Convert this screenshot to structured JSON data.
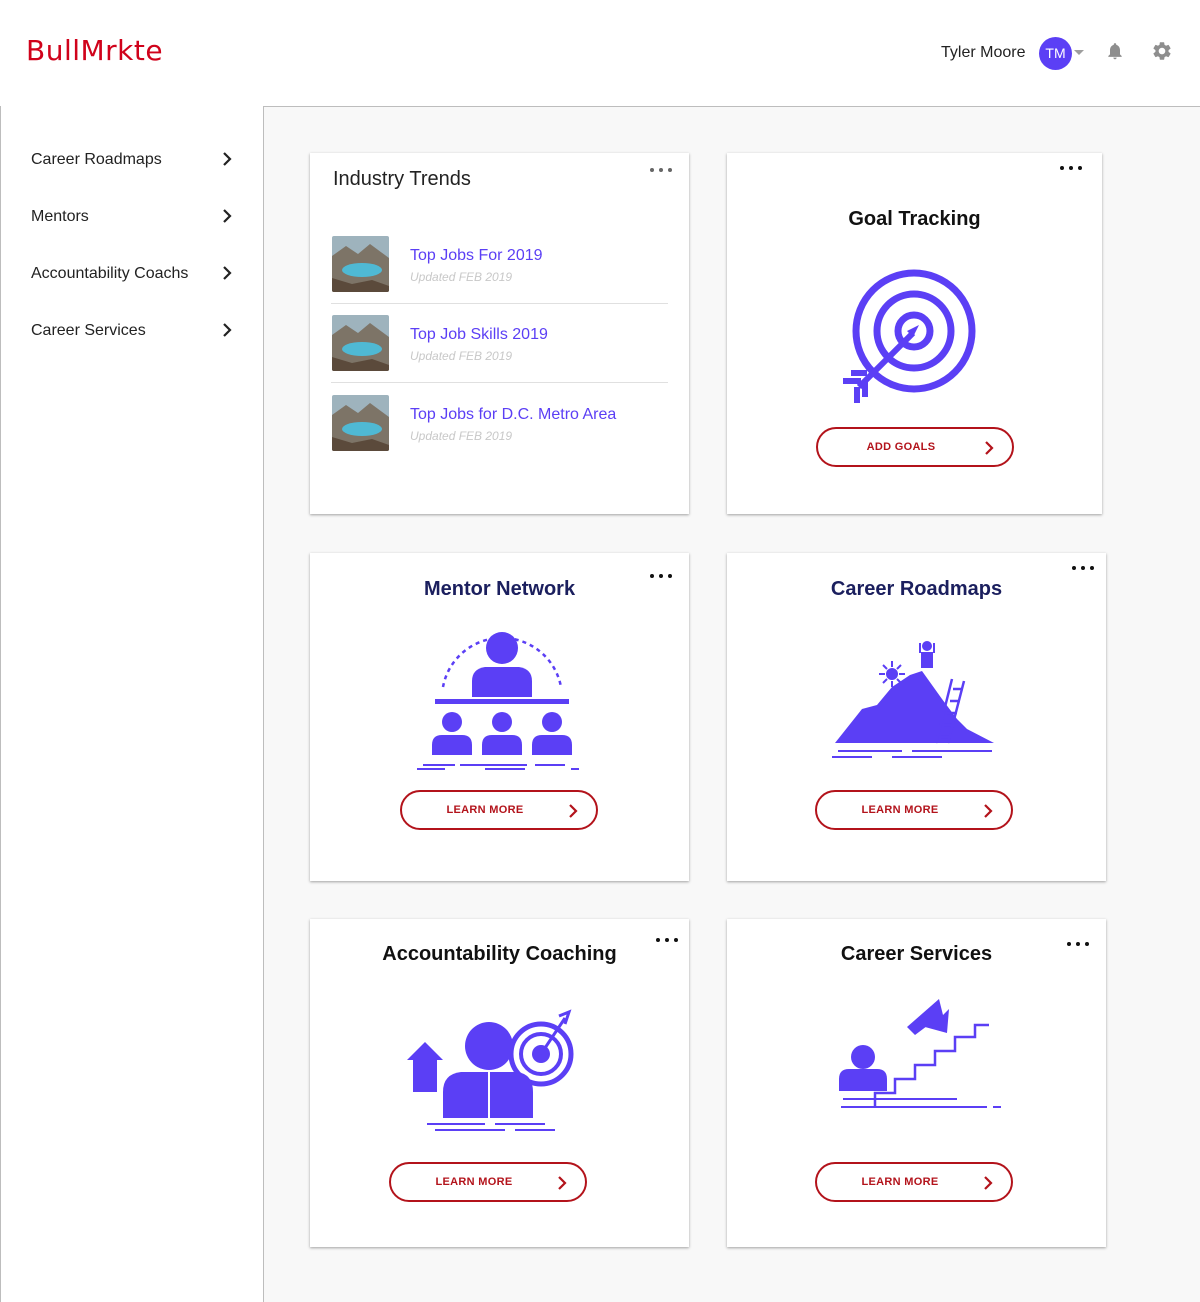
{
  "app": {
    "logo_text": "BullMrkte"
  },
  "header": {
    "user_name": "Tyler Moore",
    "avatar_initials": "TM"
  },
  "sidebar": {
    "items": [
      {
        "label": "Career Roadmaps"
      },
      {
        "label": "Mentors"
      },
      {
        "label": "Accountability Coachs"
      },
      {
        "label": "Career Services"
      }
    ]
  },
  "industry_trends": {
    "title": "Industry Trends",
    "items": [
      {
        "title": "Top Jobs For 2019",
        "updated": "Updated FEB 2019"
      },
      {
        "title": "Top Job Skills 2019",
        "updated": "Updated FEB 2019"
      },
      {
        "title": "Top Jobs for D.C. Metro Area",
        "updated": "Updated FEB 2019"
      }
    ]
  },
  "goal_tracking": {
    "title": "Goal Tracking",
    "cta": "ADD GOALS"
  },
  "mentor_network": {
    "title": "Mentor Network",
    "cta": "LEARN MORE"
  },
  "career_roadmaps": {
    "title": "Career Roadmaps",
    "cta": "LEARN MORE"
  },
  "accountability_coaching": {
    "title": "Accountability Coaching",
    "cta": "LEARN MORE"
  },
  "career_services": {
    "title": "Career Services",
    "cta": "LEARN MORE"
  },
  "colors": {
    "brand_red": "#d0021b",
    "button_red": "#b3131b",
    "accent_purple": "#5b3ff5",
    "navy_title": "#1b1f5e"
  },
  "icons": [
    "chevron-right-icon",
    "bell-icon",
    "gear-icon",
    "more-horizontal-icon",
    "caret-down-icon",
    "target-icon",
    "mentor-group-icon",
    "mountain-ladder-icon",
    "coach-target-icon",
    "stairs-arrow-icon"
  ]
}
